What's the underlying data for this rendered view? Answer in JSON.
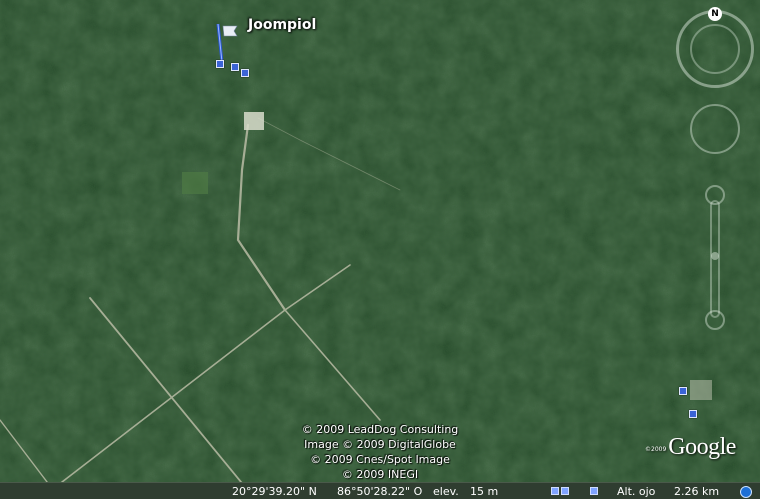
{
  "placemark": {
    "label": "Joompiol"
  },
  "credits": [
    "© 2009 LeadDog Consulting",
    "Image © 2009 DigitalGlobe",
    "© 2009 Cnes/Spot Image",
    "© 2009 INEGI"
  ],
  "brand": {
    "year": "©2009",
    "logo": "Google"
  },
  "statusbar": {
    "lat": "20°29'39.20\" N",
    "lon": "86°50'28.22\" O",
    "elev_label": "elev.",
    "elev_value": "15 m",
    "alt_label": "Alt. ojo",
    "alt_value": "2.26 km"
  },
  "navigation": {
    "north_label": "N"
  },
  "icons": [
    "flag-icon",
    "placemark-marker-icon",
    "compass-icon",
    "look-control-icon",
    "zoom-slider-icon"
  ]
}
